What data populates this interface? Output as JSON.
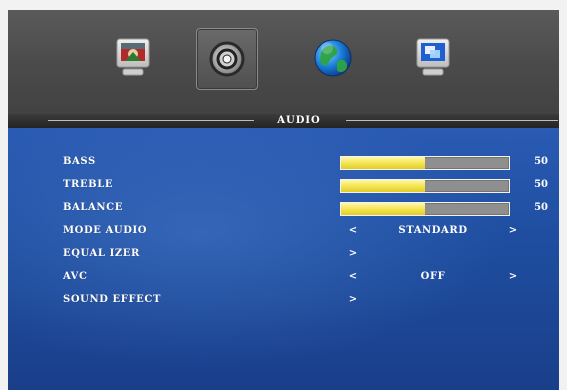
{
  "header": {
    "icons": [
      {
        "name": "picture-monitor-icon"
      },
      {
        "name": "speaker-icon"
      },
      {
        "name": "globe-icon"
      },
      {
        "name": "windows-monitor-icon"
      }
    ],
    "tab_title": "AUDIO"
  },
  "menu": {
    "items": [
      {
        "label": "BASS",
        "type": "slider",
        "value": 50,
        "max": 100,
        "display": "50"
      },
      {
        "label": "TREBLE",
        "type": "slider",
        "value": 50,
        "max": 100,
        "display": "50"
      },
      {
        "label": "BALANCE",
        "type": "slider",
        "value": 50,
        "max": 100,
        "display": "50"
      },
      {
        "label": "MODE AUDIO",
        "type": "option",
        "left_arrow": "<",
        "value": "STANDARD",
        "right_arrow": ">"
      },
      {
        "label": "EQUAL IZER",
        "type": "submenu",
        "arrow": ">"
      },
      {
        "label": "AVC",
        "type": "option",
        "left_arrow": "<",
        "value": "OFF",
        "right_arrow": ">"
      },
      {
        "label": "SOUND EFFECT",
        "type": "submenu",
        "arrow": ">"
      }
    ]
  },
  "colors": {
    "menu_blue": "#1a3f8a",
    "slider_fill": "#f3e34d",
    "slider_track": "#8f8f8f"
  }
}
